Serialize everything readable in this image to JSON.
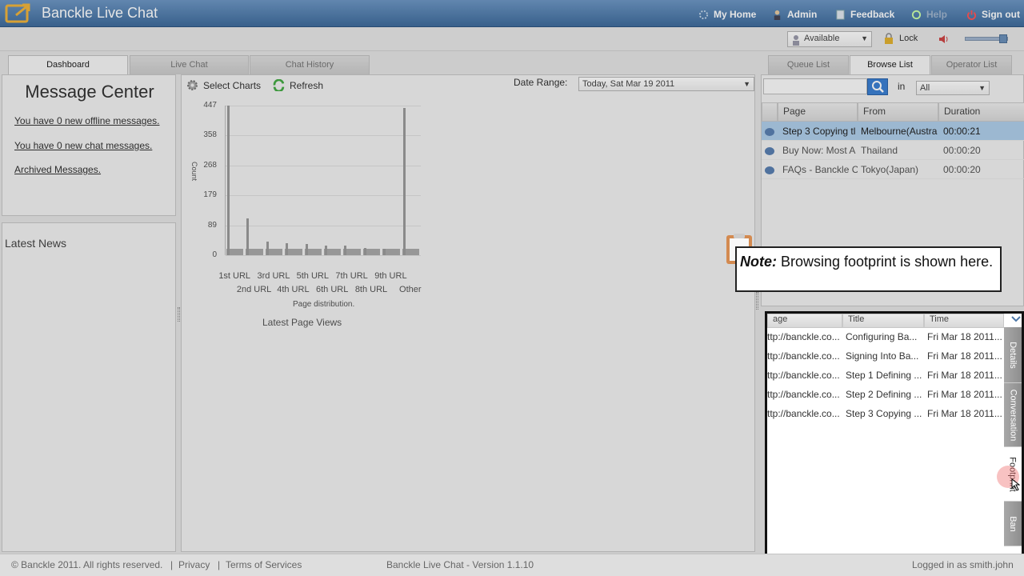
{
  "app": {
    "title": "Banckle Live Chat"
  },
  "nav": {
    "home": "My Home",
    "admin": "Admin",
    "feedback": "Feedback",
    "help": "Help",
    "signout": "Sign out"
  },
  "status": {
    "value": "Available",
    "lock": "Lock"
  },
  "tabs": {
    "dashboard": "Dashboard",
    "livechat": "Live Chat",
    "history": "Chat History"
  },
  "message_center": {
    "title": "Message Center",
    "offline": "You have 0 new offline messages.",
    "chat": "You have 0 new chat messages.",
    "archived": "Archived Messages.",
    "news": "Latest News"
  },
  "toolbar": {
    "select_charts": "Select Charts",
    "refresh": "Refresh",
    "date_range_label": "Date Range:",
    "date_range_value": "Today, Sat Mar 19 2011"
  },
  "chart_data": {
    "type": "bar",
    "categories": [
      "1st URL",
      "2nd URL",
      "3rd URL",
      "4th URL",
      "5th URL",
      "6th URL",
      "7th URL",
      "8th URL",
      "9th URL",
      "Other"
    ],
    "values": [
      447,
      110,
      40,
      35,
      33,
      28,
      28,
      22,
      18,
      440
    ],
    "yticks": [
      "447",
      "358",
      "268",
      "179",
      "89",
      "0"
    ],
    "ylabel": "Count",
    "xlabel": "Page distribution.",
    "caption": "Latest Page Views",
    "ylim": [
      0,
      447
    ]
  },
  "right_tabs": {
    "queue": "Queue List",
    "browse": "Browse List",
    "operator": "Operator List"
  },
  "search": {
    "in_label": "in",
    "filter": "All"
  },
  "browse": {
    "headers": [
      "Page",
      "From",
      "Duration"
    ],
    "rows": [
      {
        "page": "Step 3 Copying tl",
        "from": "Melbourne(Austra",
        "duration": "00:00:21"
      },
      {
        "page": "Buy Now: Most A",
        "from": "Thailand",
        "duration": "00:00:20"
      },
      {
        "page": "FAQs - Banckle C",
        "from": "Tokyo(Japan)",
        "duration": "00:00:20"
      }
    ]
  },
  "note": {
    "bold": "Note:",
    "text": " Browsing footprint is shown here."
  },
  "footprint": {
    "headers": [
      "age",
      "Title",
      "Time"
    ],
    "rows": [
      {
        "page": "ttp://banckle.co...",
        "title": "Configuring Ba...",
        "time": "Fri Mar 18 2011..."
      },
      {
        "page": "ttp://banckle.co...",
        "title": "Signing Into Ba...",
        "time": "Fri Mar 18 2011..."
      },
      {
        "page": "ttp://banckle.co...",
        "title": "Step 1 Defining ...",
        "time": "Fri Mar 18 2011..."
      },
      {
        "page": "ttp://banckle.co...",
        "title": "Step 2 Defining ...",
        "time": "Fri Mar 18 2011..."
      },
      {
        "page": "ttp://banckle.co...",
        "title": "Step 3 Copying ...",
        "time": "Fri Mar 18 2011..."
      }
    ],
    "vtabs": [
      "Details",
      "Conversation",
      "Footprint",
      "Ban"
    ]
  },
  "footer": {
    "copyright": "© Banckle 2011. All rights reserved.",
    "privacy": "Privacy",
    "terms": "Terms of Services",
    "version": "Banckle Live Chat - Version 1.1.10",
    "logged_in": "Logged in as smith.john"
  }
}
